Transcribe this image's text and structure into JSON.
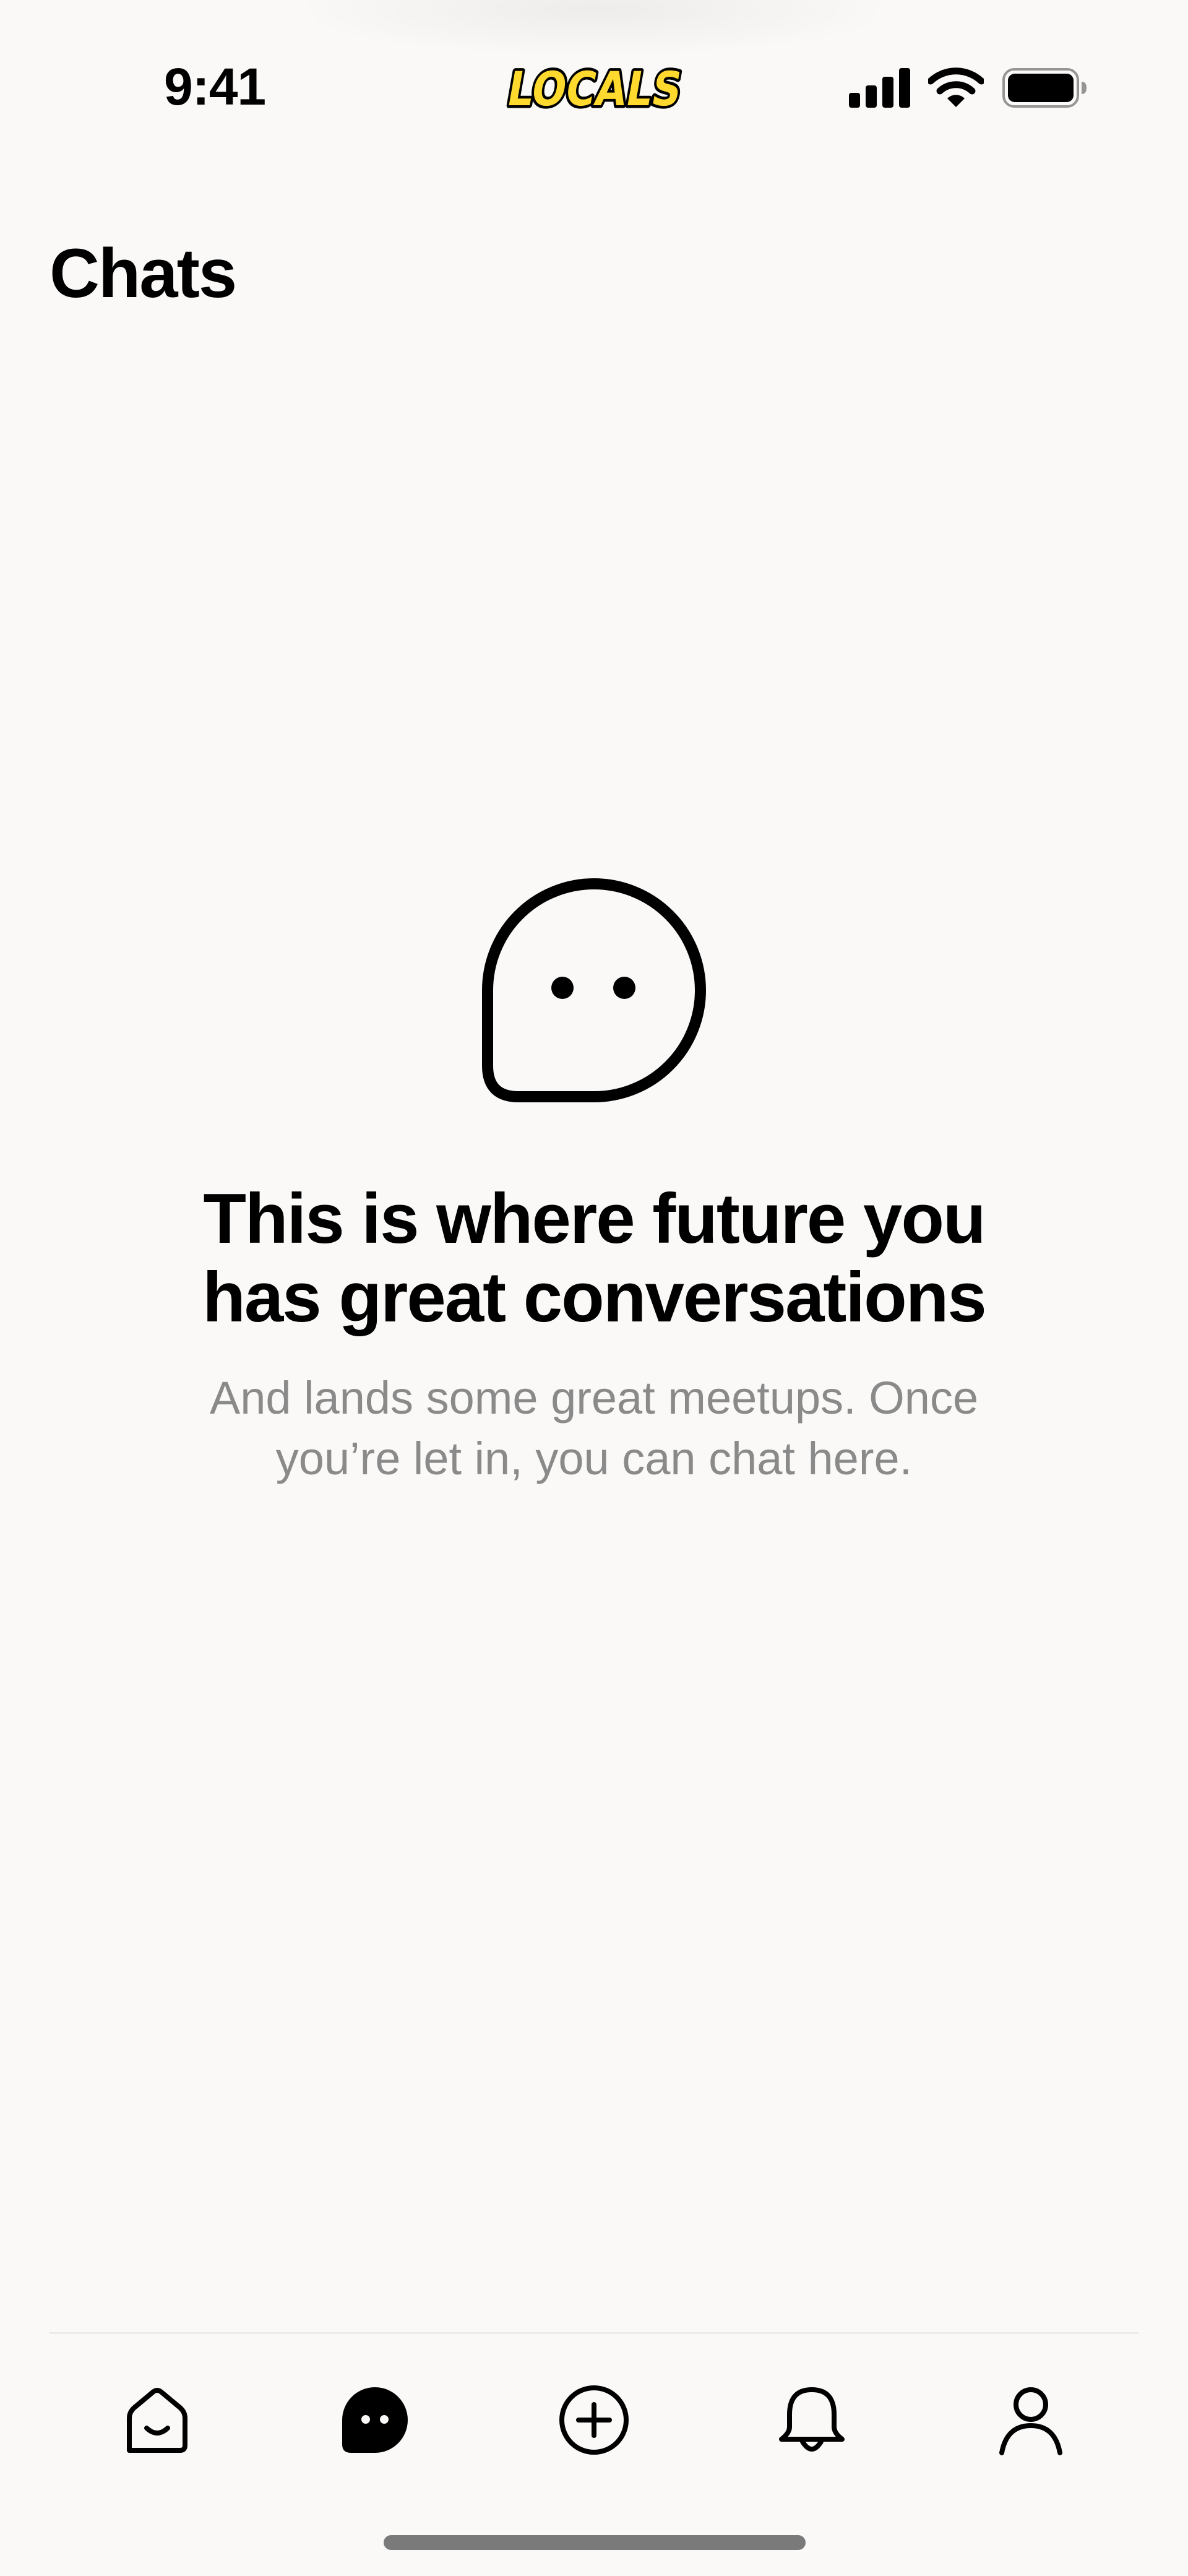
{
  "status_bar": {
    "time": "9:41",
    "logo_text": "LOCALS",
    "icons": [
      "cellular-signal-icon",
      "wifi-icon",
      "battery-icon"
    ]
  },
  "header": {
    "title": "Chats"
  },
  "empty_state": {
    "icon": "chat-bubble-face-icon",
    "heading_line1": "This is where future you",
    "heading_line2": "has great conversations",
    "subtext_line1": "And lands some great meetups. Once",
    "subtext_line2": "you’re let in, you can chat here."
  },
  "tab_bar": {
    "items": [
      {
        "name": "home",
        "icon": "home-icon",
        "active": false
      },
      {
        "name": "chats",
        "icon": "chat-bubble-icon",
        "active": true
      },
      {
        "name": "create",
        "icon": "plus-circle-icon",
        "active": false
      },
      {
        "name": "notifications",
        "icon": "bell-icon",
        "active": false
      },
      {
        "name": "profile",
        "icon": "person-icon",
        "active": false
      }
    ]
  },
  "colors": {
    "background": "#faf9f7",
    "text": "#000000",
    "subtext": "#8a8a8a",
    "logo_fill": "#ffd92e",
    "divider": "#ecebe8",
    "home_indicator": "#7a7a7a"
  }
}
